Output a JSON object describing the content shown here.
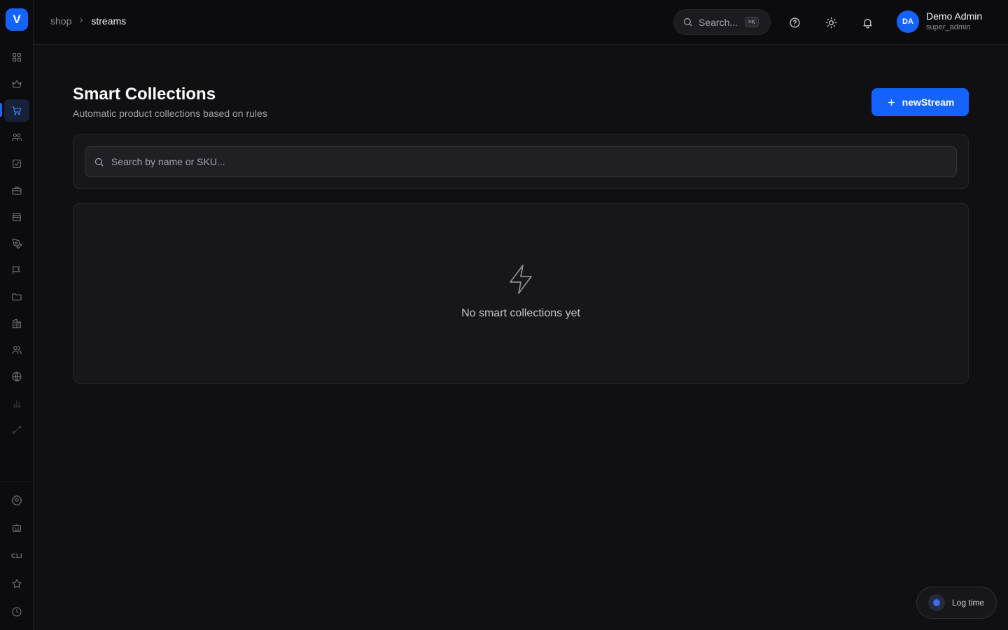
{
  "app": {
    "logo_letter": "V",
    "accent": "#1463ff",
    "background": "#101013"
  },
  "sidebar": {
    "items": [
      {
        "icon": "dashboard-grid-icon"
      },
      {
        "icon": "crown-icon"
      },
      {
        "icon": "shopping-cart-icon",
        "active": true
      },
      {
        "icon": "users-group-icon"
      },
      {
        "icon": "checkbox-icon"
      },
      {
        "icon": "briefcase-icon"
      },
      {
        "icon": "store-icon"
      },
      {
        "icon": "pen-tool-icon"
      },
      {
        "icon": "megaphone-icon"
      },
      {
        "icon": "folder-icon"
      },
      {
        "icon": "building-icon"
      },
      {
        "icon": "team-icon"
      },
      {
        "icon": "globe-icon"
      },
      {
        "icon": "bar-chart-icon"
      },
      {
        "icon": "route-icon"
      }
    ],
    "bottom_items": [
      {
        "icon": "settings-gear-icon"
      },
      {
        "icon": "bot-icon"
      },
      {
        "icon": "cli-icon",
        "label": "CLI"
      },
      {
        "icon": "star-icon"
      },
      {
        "icon": "clock-icon"
      }
    ]
  },
  "header": {
    "breadcrumb": {
      "parent": "shop",
      "current": "streams"
    },
    "search": {
      "placeholder": "Search...",
      "shortcut": "⌘K"
    },
    "user": {
      "initials": "DA",
      "name": "Demo Admin",
      "role": "super_admin"
    }
  },
  "main": {
    "title": "Smart Collections",
    "subtitle": "Automatic product collections based on rules",
    "new_button_label": "newStream",
    "search_placeholder": "Search by name or SKU...",
    "empty_state": {
      "icon": "lightning-bolt-icon",
      "text": "No smart collections yet"
    }
  },
  "floating": {
    "log_time_label": "Log time"
  }
}
